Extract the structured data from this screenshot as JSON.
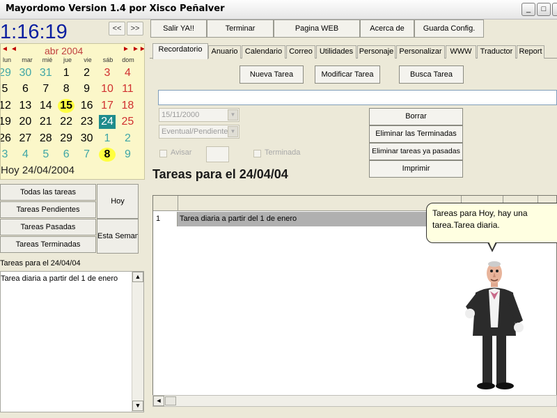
{
  "window": {
    "title": "Mayordomo Version 1.4  por Xisco Peñalver",
    "minimize": "_",
    "maximize": "□",
    "close": "✕"
  },
  "clock": "1:16:19",
  "nav": {
    "prev": "<<",
    "next": ">>"
  },
  "toolbar": {
    "salir": "Salir YA!!",
    "terminar": "Terminar",
    "pagina_web": "Pagina WEB",
    "acerca_de": "Acerca de",
    "guarda_config": "Guarda Config."
  },
  "calendar": {
    "month_label": "abr 2004",
    "prev_year": "◄◄",
    "prev_month": "◄",
    "next_month": "►",
    "next_year": "►►",
    "weekdays": [
      "lun",
      "mar",
      "mié",
      "jue",
      "vie",
      "sáb",
      "dom"
    ],
    "weeks": [
      [
        "29",
        "30",
        "31",
        "1",
        "2",
        "3",
        "4"
      ],
      [
        "5",
        "6",
        "7",
        "8",
        "9",
        "10",
        "11"
      ],
      [
        "12",
        "13",
        "14",
        "15",
        "16",
        "17",
        "18"
      ],
      [
        "19",
        "20",
        "21",
        "22",
        "23",
        "24",
        "25"
      ],
      [
        "26",
        "27",
        "28",
        "29",
        "30",
        "1",
        "2"
      ],
      [
        "3",
        "4",
        "5",
        "6",
        "7",
        "8",
        "9"
      ]
    ],
    "today_label": "Hoy 24/04/2004",
    "selected_day": "24",
    "marked_days": [
      "15",
      "8"
    ]
  },
  "left_buttons": {
    "todas": "Todas las tareas",
    "pendientes": "Tareas Pendientes",
    "pasadas": "Tareas Pasadas",
    "terminadas": "Tareas Terminadas",
    "hoy": "Hoy",
    "semana": "Esta Semana"
  },
  "left_tasks": {
    "header": "Tareas para el 24/04/04",
    "items": [
      "Tarea diaria a partir del 1 de enero"
    ]
  },
  "tabs": [
    "Recordatorio",
    "Anuario",
    "Calendario",
    "Correo",
    "Utilidades",
    "Personaje",
    "Personalizar",
    "WWW",
    "Traductor",
    "Report"
  ],
  "actions": {
    "nueva": "Nueva Tarea",
    "modificar": "Modificar Tarea",
    "buscar": "Busca Tarea"
  },
  "task_input": {
    "value": ""
  },
  "date_combo": "15/11/2000",
  "type_combo": "Eventual/Pendiente",
  "avisar_label": "Avisar",
  "avisar_value": "",
  "terminada_label": "Terminada",
  "side_buttons": {
    "borrar": "Borrar",
    "eliminar_terminadas": "Eliminar las Terminadas",
    "eliminar_pasadas": "Eliminar tareas ya pasadas",
    "imprimir": "Imprimir"
  },
  "tareas_title": "Tareas para el 24/04/04",
  "grid": {
    "rows": [
      {
        "num": "1",
        "text": "Tarea diaria a partir del 1 de enero"
      }
    ]
  },
  "bubble": "Tareas para Hoy, hay una tarea.Tarea diaria.",
  "icons": {
    "scroll_left": "◄",
    "scroll_up": "▲",
    "scroll_down": "▼",
    "dropdown": "▼"
  },
  "colors": {
    "clock": "#0a1fa0",
    "calendar_bg": "#fbf7c9",
    "today_bg": "#1f8c8c",
    "marked_bg": "#ffff40",
    "weekend": "#d03030",
    "other_month": "#3fa6a6"
  }
}
